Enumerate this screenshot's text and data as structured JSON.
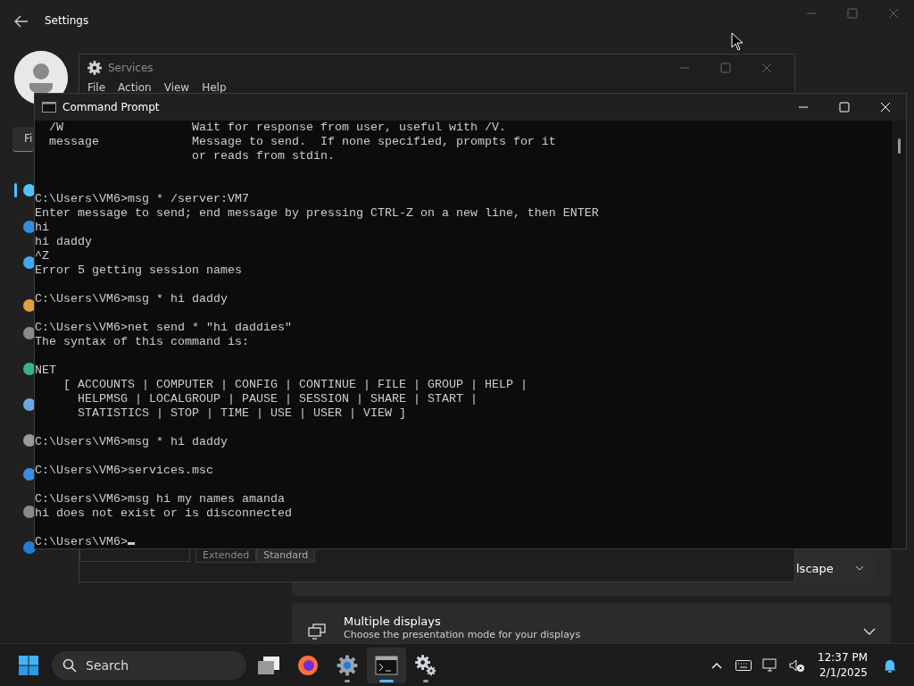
{
  "settings": {
    "title": "Settings",
    "search": {
      "placeholder": "Fi"
    },
    "orientation": {
      "value": "lscape"
    },
    "multiple_displays": {
      "title": "Multiple displays",
      "subtitle": "Choose the presentation mode for your displays",
      "expanded": false
    }
  },
  "services": {
    "title": "Services",
    "menu": [
      "File",
      "Action",
      "View",
      "Help"
    ],
    "tabs": [
      {
        "label": "Extended",
        "selected": false
      },
      {
        "label": "Standard",
        "selected": true
      }
    ]
  },
  "command_prompt": {
    "title": "Command Prompt",
    "prompt": "C:\\Users\\VM6>",
    "lines": [
      {
        "kind": "text",
        "text": "  /W                  Wait for response from user, useful with /V."
      },
      {
        "kind": "text",
        "text": "  message             Message to send.  If none specified, prompts for it"
      },
      {
        "kind": "text",
        "text": "                      or reads from stdin."
      },
      {
        "kind": "blank"
      },
      {
        "kind": "blank"
      },
      {
        "kind": "text",
        "text": "C:\\Users\\VM6>msg * /server:VM7"
      },
      {
        "kind": "text",
        "text": "Enter message to send; end message by pressing CTRL-Z on a new line, then ENTER"
      },
      {
        "kind": "text",
        "text": "hi"
      },
      {
        "kind": "text",
        "text": "hi daddy"
      },
      {
        "kind": "text",
        "text": "^Z"
      },
      {
        "kind": "text",
        "text": "Error 5 getting session names"
      },
      {
        "kind": "blank"
      },
      {
        "kind": "text",
        "text": "C:\\Users\\VM6>msg * hi daddy"
      },
      {
        "kind": "blank"
      },
      {
        "kind": "text",
        "text": "C:\\Users\\VM6>net send * \"hi daddies\""
      },
      {
        "kind": "text",
        "text": "The syntax of this command is:"
      },
      {
        "kind": "blank"
      },
      {
        "kind": "text",
        "text": "NET"
      },
      {
        "kind": "text",
        "text": "    [ ACCOUNTS | COMPUTER | CONFIG | CONTINUE | FILE | GROUP | HELP |"
      },
      {
        "kind": "text",
        "text": "      HELPMSG | LOCALGROUP | PAUSE | SESSION | SHARE | START |"
      },
      {
        "kind": "text",
        "text": "      STATISTICS | STOP | TIME | USE | USER | VIEW ]"
      },
      {
        "kind": "blank"
      },
      {
        "kind": "text",
        "text": "C:\\Users\\VM6>msg * hi daddy"
      },
      {
        "kind": "blank"
      },
      {
        "kind": "text",
        "text": "C:\\Users\\VM6>services.msc"
      },
      {
        "kind": "blank"
      },
      {
        "kind": "text",
        "text": "C:\\Users\\VM6>msg hi my names amanda"
      },
      {
        "kind": "text",
        "text": "hi does not exist or is disconnected"
      },
      {
        "kind": "blank"
      }
    ]
  },
  "taskbar": {
    "search": {
      "placeholder": "Search"
    },
    "apps": [
      {
        "kind": "taskview",
        "selected": false,
        "running": false
      },
      {
        "kind": "firefox",
        "selected": false,
        "running": false
      },
      {
        "kind": "settings",
        "selected": false,
        "running": true
      },
      {
        "kind": "cmd",
        "selected": true,
        "running": true
      },
      {
        "kind": "services",
        "selected": false,
        "running": true
      }
    ],
    "time": "12:37 PM",
    "date": "2/1/2025"
  }
}
